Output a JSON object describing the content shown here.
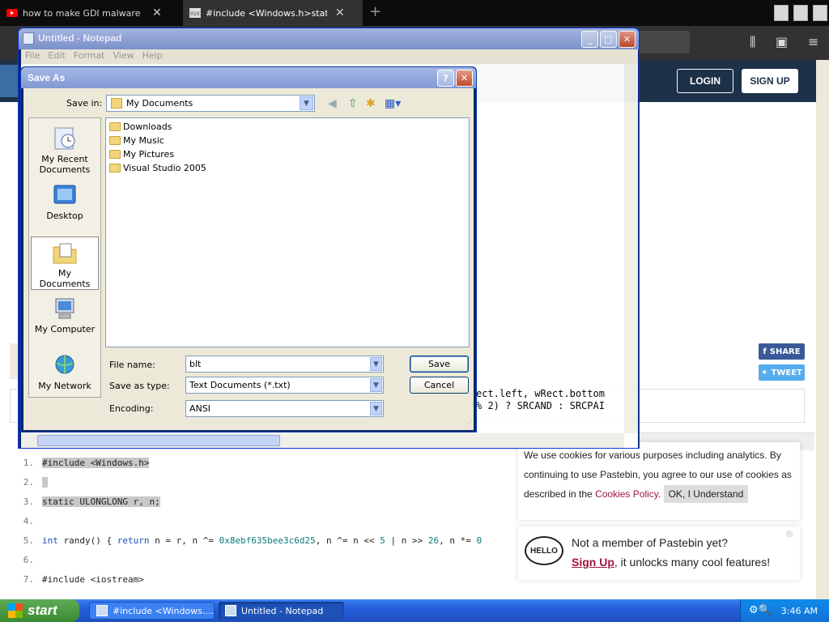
{
  "browser": {
    "tabs": [
      {
        "title": "how to make GDI malware in c++"
      },
      {
        "title": "#include <Windows.h>static ULON"
      }
    ],
    "new_tab": "+"
  },
  "page": {
    "header": {
      "login": "LOGIN",
      "signup": "SIGN UP"
    },
    "share": "SHARE",
    "tweet": "TWEET",
    "code_lines": [
      {
        "num": "1.",
        "text": "#include <Windows.h>"
      },
      {
        "num": "2.",
        "text": " "
      },
      {
        "num": "3.",
        "text": "static ULONGLONG r, n;"
      },
      {
        "num": "4.",
        "text": ""
      },
      {
        "num": "5.",
        "kw": "int",
        "pre": " randy() { ",
        "ret": "return",
        "mid": " n = r, n ^= ",
        "hex": "0x8ebf635bee3c6d25",
        "mid2": ", n ^= n << ",
        "a": "5",
        "mid3": " | n >> ",
        "b": "26",
        "mid4": ", n *= ",
        "c": "0"
      },
      {
        "num": "6.",
        "text": ""
      },
      {
        "num": "7.",
        "text": "#include <iostream>"
      }
    ],
    "cookie": {
      "text_before": "We use cookies for various purposes including analytics. By continuing to use Pastebin, you agree to our use of cookies as described in the ",
      "link": "Cookies Policy",
      "text_after": ".",
      "ok": "OK, I Understand"
    },
    "notice": {
      "logo": "HELLO",
      "title": "Not a member of Pastebin yet?",
      "link": "Sign Up",
      "body": ", it unlocks many cool features!",
      "close": "⊗"
    }
  },
  "notepad": {
    "title": "Untitled - Notepad",
    "menu": [
      "File",
      "Edit",
      "Format",
      "View",
      "Help"
    ],
    "text_line1": "ect.left, wRect.bottom",
    "text_line2": "% 2) ? SRCAND : SRCPAI"
  },
  "save_as": {
    "title": "Save As",
    "help_btn": "?",
    "close_btn": "✕",
    "save_in_label": "Save in:",
    "save_in_value": "My Documents",
    "places": [
      "My Recent Documents",
      "Desktop",
      "My Documents",
      "My Computer",
      "My Network"
    ],
    "files": [
      "Downloads",
      "My Music",
      "My Pictures",
      "Visual Studio 2005"
    ],
    "file_name_label": "File name:",
    "file_name_value": "blt",
    "save_type_label": "Save as type:",
    "save_type_value": "Text Documents (*.txt)",
    "encoding_label": "Encoding:",
    "encoding_value": "ANSI",
    "save_label": "Save",
    "cancel_label": "Cancel"
  },
  "taskbar": {
    "start": "start",
    "items": [
      "#include <Windows....",
      "Untitled - Notepad"
    ],
    "clock": "3:46 AM"
  },
  "colors": {
    "accent": "#1d3148",
    "link": "#a0153e",
    "xp_blue": "#245edb"
  }
}
